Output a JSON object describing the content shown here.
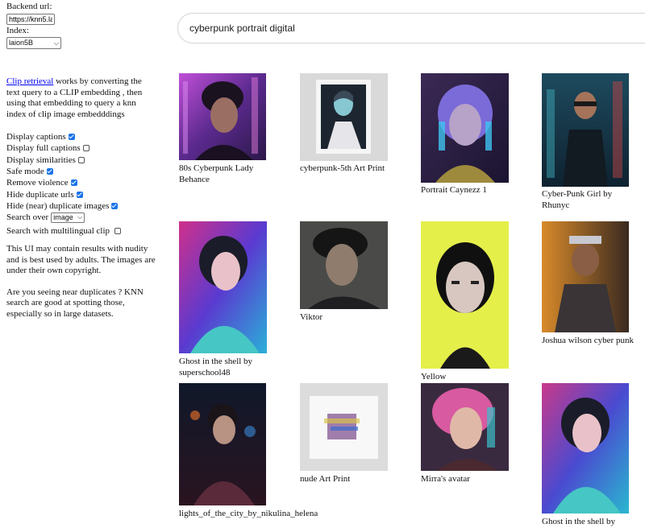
{
  "sidebar": {
    "backend_label": "Backend url:",
    "backend_value": "https://knn5.la",
    "index_label": "Index:",
    "index_value": "laion5B",
    "about_link": "Clip retrieval",
    "about_text": " works by converting the text query to a CLIP embedding , then using that embedding to query a knn index of clip image embedddings",
    "options": [
      {
        "label": "Display captions",
        "checked": true
      },
      {
        "label": "Display full captions",
        "checked": false
      },
      {
        "label": "Display similarities",
        "checked": false
      },
      {
        "label": "Safe mode",
        "checked": true
      },
      {
        "label": "Remove violence",
        "checked": true
      },
      {
        "label": "Hide duplicate urls",
        "checked": true
      },
      {
        "label": "Hide (near) duplicate images",
        "checked": true
      }
    ],
    "search_over_label": "Search over",
    "search_over_value": "image",
    "multilingual_label": "Search with multilingual clip",
    "multilingual_checked": false,
    "note1": "This UI may contain results with nudity and is best used by adults. The images are under their own copyright.",
    "note2": "Are you seeing near duplicates ? KNN search are good at spotting those, especially so in large datasets."
  },
  "search": {
    "query": "cyberpunk portrait digital"
  },
  "results": [
    {
      "caption": "80s Cyberpunk Lady Behance"
    },
    {
      "caption": "cyberpunk-5th Art Print"
    },
    {
      "caption": "Portrait Caynezz 1"
    },
    {
      "caption": "Cyber-Punk Girl by Rhunyc"
    },
    {
      "caption": "Ghost in the shell by superschool48"
    },
    {
      "caption": "Viktor"
    },
    {
      "caption": "Yellow"
    },
    {
      "caption": "Joshua wilson cyber punk"
    },
    {
      "caption": "lights_of_the_city_by_nikulina_helena"
    },
    {
      "caption": "nude Art Print"
    },
    {
      "caption": "Mirra's avatar"
    },
    {
      "caption": "Ghost in the shell by"
    }
  ]
}
